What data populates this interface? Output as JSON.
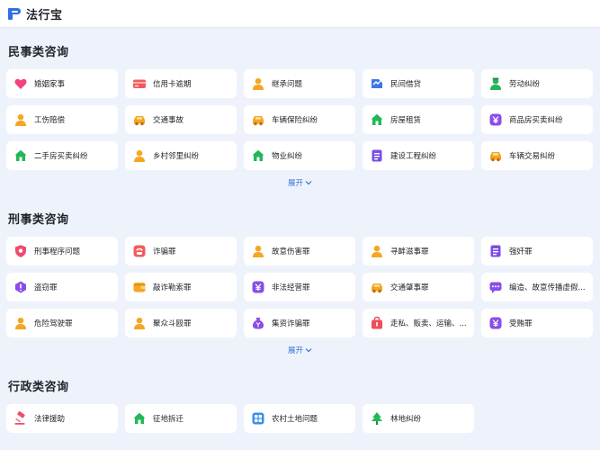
{
  "app": {
    "logo_text": "法行宝"
  },
  "colors": {
    "accent": "#3a6fd8",
    "background": "#eef3fb"
  },
  "sections": [
    {
      "title": "民事类咨询",
      "expand_label": "展开",
      "items": [
        {
          "label": "婚姻家事",
          "icon": "heart-icon"
        },
        {
          "label": "信用卡逾期",
          "icon": "credit-card-icon"
        },
        {
          "label": "继承问题",
          "icon": "person-icon"
        },
        {
          "label": "民间借贷",
          "icon": "handshake-icon"
        },
        {
          "label": "劳动纠纷",
          "icon": "worker-icon"
        },
        {
          "label": "工伤赔偿",
          "icon": "person-icon"
        },
        {
          "label": "交通事故",
          "icon": "car-icon"
        },
        {
          "label": "车辆保险纠纷",
          "icon": "car-icon"
        },
        {
          "label": "房屋租赁",
          "icon": "house-icon"
        },
        {
          "label": "商品房买卖纠纷",
          "icon": "money-icon"
        },
        {
          "label": "二手房买卖纠纷",
          "icon": "house-icon"
        },
        {
          "label": "乡村邻里纠纷",
          "icon": "person-icon"
        },
        {
          "label": "物业纠纷",
          "icon": "house-icon"
        },
        {
          "label": "建设工程纠纷",
          "icon": "document-icon"
        },
        {
          "label": "车辆交易纠纷",
          "icon": "car-icon"
        }
      ]
    },
    {
      "title": "刑事类咨询",
      "expand_label": "展开",
      "items": [
        {
          "label": "刑事程序问题",
          "icon": "shield-icon"
        },
        {
          "label": "诈骗罪",
          "icon": "phone-icon"
        },
        {
          "label": "故意伤害罪",
          "icon": "person-icon"
        },
        {
          "label": "寻衅滋事罪",
          "icon": "person-icon"
        },
        {
          "label": "强奸罪",
          "icon": "document-icon"
        },
        {
          "label": "盗窃罪",
          "icon": "alert-icon"
        },
        {
          "label": "敲诈勒索罪",
          "icon": "wallet-icon"
        },
        {
          "label": "非法经营罪",
          "icon": "money-icon"
        },
        {
          "label": "交通肇事罪",
          "icon": "car-icon"
        },
        {
          "label": "编造、故意传播虚假...",
          "icon": "message-icon"
        },
        {
          "label": "危险驾驶罪",
          "icon": "person-icon"
        },
        {
          "label": "聚众斗殴罪",
          "icon": "person-icon"
        },
        {
          "label": "集资诈骗罪",
          "icon": "money-bag-icon"
        },
        {
          "label": "走私、贩卖、运输、...",
          "icon": "bag-icon"
        },
        {
          "label": "受贿罪",
          "icon": "money-icon"
        }
      ]
    },
    {
      "title": "行政类咨询",
      "items": [
        {
          "label": "法律援助",
          "icon": "gavel-icon"
        },
        {
          "label": "征地拆迁",
          "icon": "house-icon"
        },
        {
          "label": "农村土地问题",
          "icon": "grid-icon"
        },
        {
          "label": "林地纠纷",
          "icon": "tree-icon"
        }
      ]
    }
  ]
}
